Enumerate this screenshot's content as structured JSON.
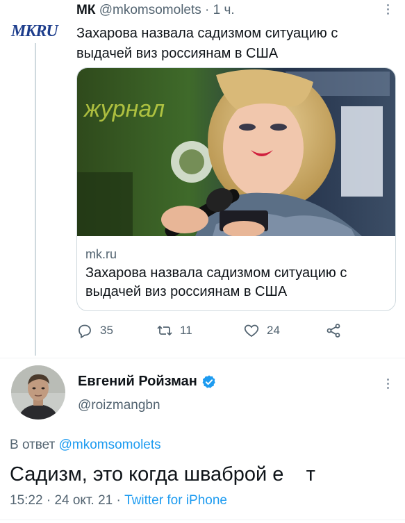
{
  "parent_tweet": {
    "logo_text": "MKRU",
    "author_name": "МК",
    "author_handle": "@mkomsomolets",
    "separator": "·",
    "time": "1 ч.",
    "text": "Захарова назвала садизмом ситуацию с выдачей виз россиянам в США",
    "card": {
      "domain": "mk.ru",
      "title": "Захарова назвала садизмом ситуацию с выдачей виз россиянам в США"
    },
    "actions": {
      "replies": "35",
      "retweets": "11",
      "likes": "24"
    }
  },
  "reply_tweet": {
    "author_name": "Евгений Ройзман",
    "author_handle": "@roizmangbn",
    "reply_prefix": "В ответ",
    "reply_to_handle": "@mkomsomolets",
    "text": "Садизм, это когда шваброй е    т",
    "time": "15:22",
    "date": "24 окт. 21",
    "client": "Twitter for iPhone",
    "sep": "·"
  },
  "colors": {
    "accent": "#1d9bf0",
    "secondary_text": "#536471",
    "primary_text": "#0f1419",
    "logo": "#1d3d8c"
  }
}
